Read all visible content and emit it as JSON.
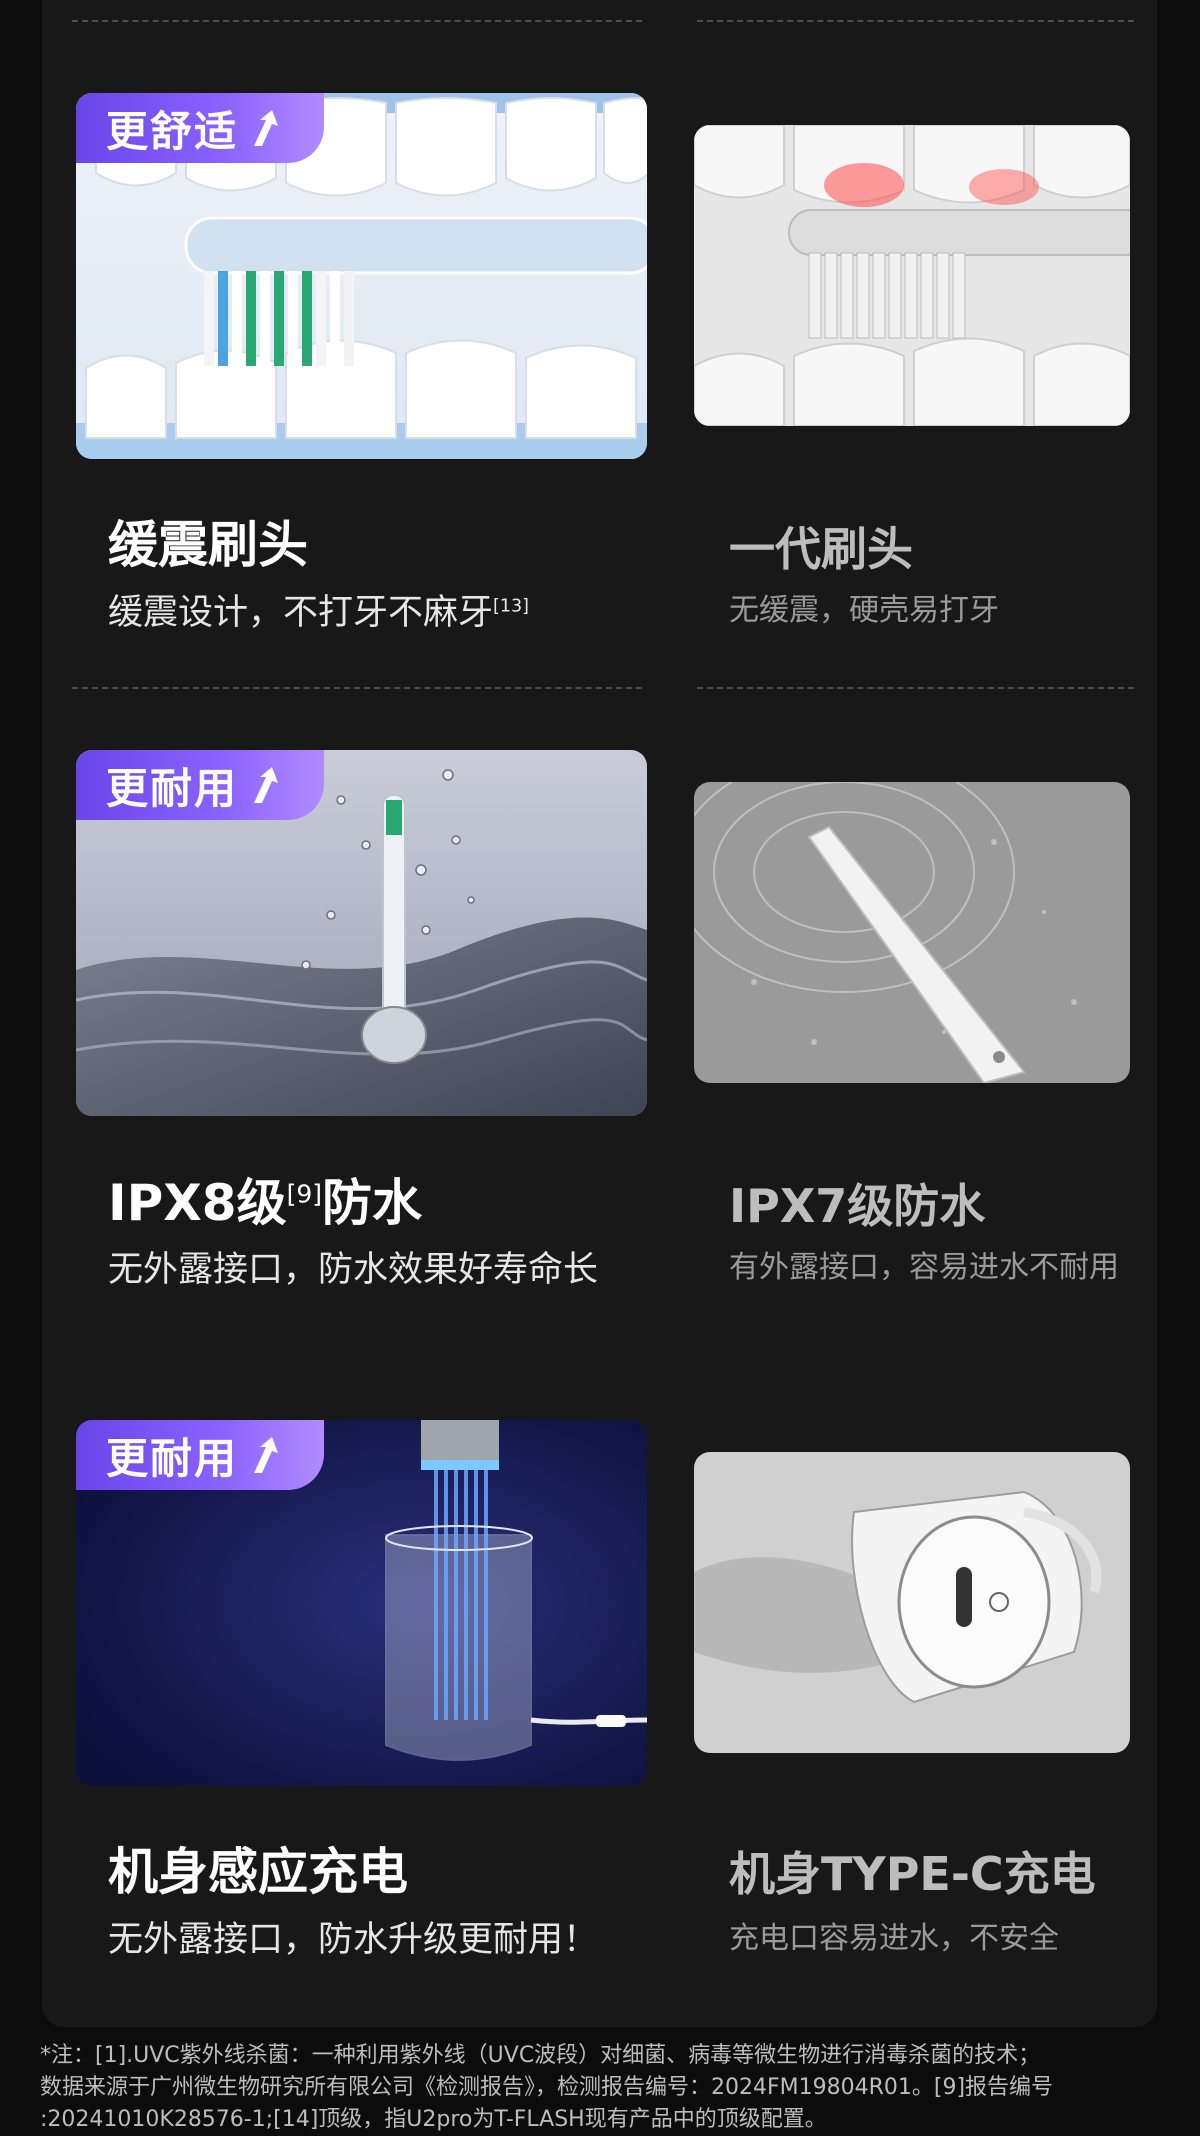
{
  "colors": {
    "badge_gradient": [
      "#6a45e8",
      "#b08cff"
    ],
    "panel_bg": "#181818",
    "page_bg": "#0c0c0c"
  },
  "rows": [
    {
      "new": {
        "badge": "更舒适",
        "badge_icon": "arrow-up-icon",
        "title": "缓震刷头",
        "subtitle": "缓震设计，不打牙不麻牙",
        "subtitle_sup": "[13]",
        "image": "cushioned-brush-head-image"
      },
      "old": {
        "title": "一代刷头",
        "subtitle": "无缓震，硬壳易打牙",
        "image": "first-gen-brush-head-image"
      }
    },
    {
      "new": {
        "badge": "更耐用",
        "badge_icon": "arrow-up-icon",
        "title_pre": "IPX8级",
        "title_sup": "[9]",
        "title_post": "防水",
        "subtitle": "无外露接口，防水效果好寿命长",
        "image": "ipx8-waterproof-image"
      },
      "old": {
        "title": "IPX7级防水",
        "subtitle": "有外露接口，容易进水不耐用",
        "image": "ipx7-waterproof-image"
      }
    },
    {
      "new": {
        "badge": "更耐用",
        "badge_icon": "arrow-up-icon",
        "title": "机身感应充电",
        "subtitle": "无外露接口，防水升级更耐用！",
        "image": "induction-charging-image"
      },
      "old": {
        "title": "机身TYPE-C充电",
        "subtitle": "充电口容易进水，不安全",
        "image": "type-c-charging-image"
      }
    }
  ],
  "footnote": {
    "line1": "*注：[1].UVC紫外线杀菌：一种利用紫外线（UVC波段）对细菌、病毒等微生物进行消毒杀菌的技术；",
    "line2": "数据来源于广州微生物研究所有限公司《检测报告》，检测报告编号：2024FM19804R01。[9]报告编号",
    "line3": ":20241010K28576-1;[14]顶级，指U2pro为T-FLASH现有产品中的顶级配置。"
  }
}
